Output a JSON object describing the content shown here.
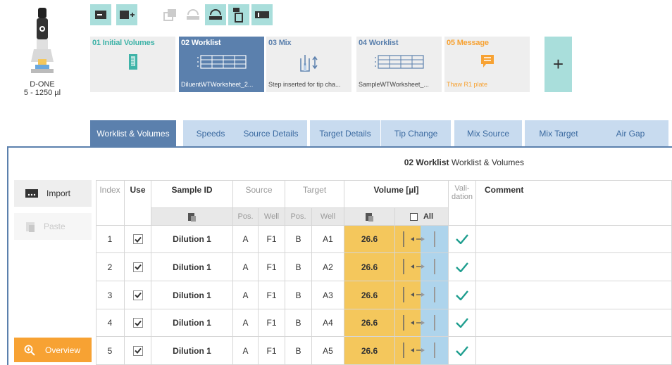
{
  "device": {
    "name": "D-ONE",
    "range": "5 - 1250 µl",
    "icon": "pipette-icon"
  },
  "toolbar": {
    "buttons": [
      {
        "name": "add-message-button",
        "icon": "message-plus-icon",
        "enabled": true
      },
      {
        "name": "add-step-button",
        "icon": "step-plus-icon",
        "enabled": true
      },
      {
        "name": "copy-step-button",
        "icon": "copy-icon",
        "enabled": false
      },
      {
        "name": "undo-button",
        "icon": "undo-icon",
        "enabled": false
      },
      {
        "name": "redo-button",
        "icon": "redo-icon",
        "enabled": true
      },
      {
        "name": "delete-step-button",
        "icon": "trash-icon",
        "enabled": true
      },
      {
        "name": "toggle-view-button",
        "icon": "layout-icon",
        "enabled": true
      }
    ]
  },
  "steps": [
    {
      "title": "01 Initial Volumes",
      "subtitle": "",
      "icon": "volume-tube-icon",
      "color": "#3fb3a8",
      "active": false
    },
    {
      "title": "02 Worklist",
      "subtitle": "DiluentWTWorksheet_2...",
      "icon": "worklist-icon",
      "color": "#ffffff",
      "active": true
    },
    {
      "title": "03 Mix",
      "subtitle": "Step inserted for tip cha...",
      "icon": "mix-icon",
      "color": "#5b80ad",
      "active": false
    },
    {
      "title": "04 Worklist",
      "subtitle": "SampleWTWorksheet_...",
      "icon": "worklist-icon",
      "color": "#5b80ad",
      "active": false
    },
    {
      "title": "05 Message",
      "subtitle": "Thaw R1 plate",
      "icon": "message-icon",
      "color": "#f7a233",
      "active": false
    }
  ],
  "add_step_label": "+",
  "tabs": [
    {
      "label": "Worklist & Volumes",
      "active": true
    },
    {
      "label": "Speeds",
      "active": false
    },
    {
      "label": "Source Details",
      "active": false
    },
    {
      "label": "Target Details",
      "active": false
    },
    {
      "label": "Tip Change",
      "active": false
    },
    {
      "label": "Mix Source",
      "active": false
    },
    {
      "label": "Mix Target",
      "active": false
    },
    {
      "label": "Air Gap",
      "active": false
    }
  ],
  "panel": {
    "step_name": "02 Worklist",
    "section_name": "Worklist & Volumes"
  },
  "side": {
    "import_label": "Import",
    "paste_label": "Paste",
    "overview_label": "Overview"
  },
  "table": {
    "headers": {
      "index": "Index",
      "use": "Use",
      "sample_id": "Sample ID",
      "source": "Source",
      "target": "Target",
      "volume": "Volume [µl]",
      "validation": "Vali-\ndation",
      "comment": "Comment"
    },
    "subheaders": {
      "pos": "Pos.",
      "well": "Well",
      "all": "All"
    },
    "rows": [
      {
        "index": "1",
        "use": true,
        "sample_id": "Dilution 1",
        "source_pos": "A",
        "source_well": "F1",
        "target_pos": "B",
        "target_well": "A1",
        "volume": "26.6",
        "valid": true
      },
      {
        "index": "2",
        "use": true,
        "sample_id": "Dilution 1",
        "source_pos": "A",
        "source_well": "F1",
        "target_pos": "B",
        "target_well": "A2",
        "volume": "26.6",
        "valid": true
      },
      {
        "index": "3",
        "use": true,
        "sample_id": "Dilution 1",
        "source_pos": "A",
        "source_well": "F1",
        "target_pos": "B",
        "target_well": "A3",
        "volume": "26.6",
        "valid": true
      },
      {
        "index": "4",
        "use": true,
        "sample_id": "Dilution 1",
        "source_pos": "A",
        "source_well": "F1",
        "target_pos": "B",
        "target_well": "A4",
        "volume": "26.6",
        "valid": true
      },
      {
        "index": "5",
        "use": true,
        "sample_id": "Dilution 1",
        "source_pos": "A",
        "source_well": "F1",
        "target_pos": "B",
        "target_well": "A5",
        "volume": "26.6",
        "valid": true
      }
    ]
  },
  "colors": {
    "accent": "#5b80ad",
    "teal": "#a9dedb",
    "orange": "#f7a233",
    "volume": "#f4c75c",
    "check": "#1f9e8f"
  }
}
